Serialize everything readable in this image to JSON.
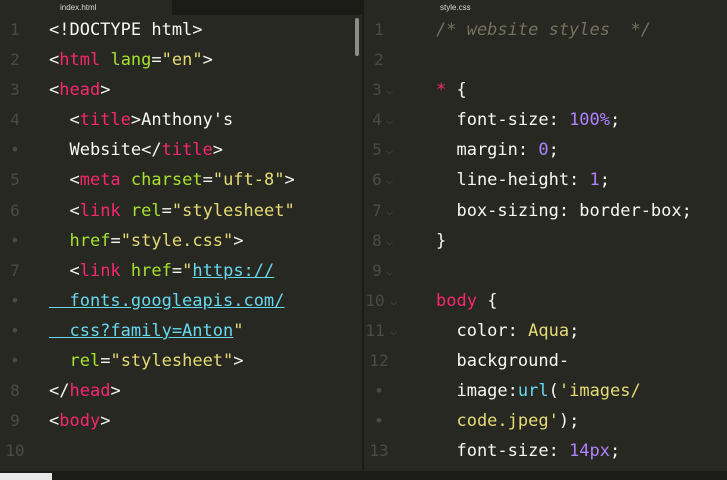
{
  "tabs": {
    "left": "index.html",
    "right": "style.css"
  },
  "left_lines": [
    {
      "num": "1",
      "parts": [
        [
          "tx",
          "<!DOCTYPE html>"
        ]
      ]
    },
    {
      "num": "2",
      "parts": [
        [
          "tx",
          "<"
        ],
        [
          "tg",
          "html"
        ],
        [
          "tx",
          " "
        ],
        [
          "at",
          "lang"
        ],
        [
          "tx",
          "="
        ],
        [
          "st",
          "\"en\""
        ],
        [
          "tx",
          ">"
        ]
      ]
    },
    {
      "num": "3",
      "parts": [
        [
          "tx",
          "<"
        ],
        [
          "tg",
          "head"
        ],
        [
          "tx",
          ">"
        ]
      ]
    },
    {
      "num": "4",
      "parts": [
        [
          "tx",
          "  <"
        ],
        [
          "tg",
          "title"
        ],
        [
          "tx",
          ">Anthony's"
        ]
      ]
    },
    {
      "num": "•",
      "parts": [
        [
          "tx",
          "  Website</"
        ],
        [
          "tg",
          "title"
        ],
        [
          "tx",
          ">"
        ]
      ]
    },
    {
      "num": "5",
      "parts": [
        [
          "tx",
          "  <"
        ],
        [
          "tg",
          "meta"
        ],
        [
          "tx",
          " "
        ],
        [
          "at",
          "charset"
        ],
        [
          "tx",
          "="
        ],
        [
          "st",
          "\"uft-8\""
        ],
        [
          "tx",
          ">"
        ]
      ]
    },
    {
      "num": "6",
      "parts": [
        [
          "tx",
          "  <"
        ],
        [
          "tg",
          "link"
        ],
        [
          "tx",
          " "
        ],
        [
          "at",
          "rel"
        ],
        [
          "tx",
          "="
        ],
        [
          "st",
          "\"stylesheet\""
        ]
      ]
    },
    {
      "num": "•",
      "parts": [
        [
          "tx",
          "  "
        ],
        [
          "at",
          "href"
        ],
        [
          "tx",
          "="
        ],
        [
          "st",
          "\"style.css\""
        ],
        [
          "tx",
          ">"
        ]
      ]
    },
    {
      "num": "7",
      "parts": [
        [
          "tx",
          "  <"
        ],
        [
          "tg",
          "link"
        ],
        [
          "tx",
          " "
        ],
        [
          "at",
          "href"
        ],
        [
          "tx",
          "="
        ],
        [
          "st",
          "\""
        ],
        [
          "un",
          "https://"
        ]
      ]
    },
    {
      "num": "•",
      "parts": [
        [
          "un",
          "  fonts.googleapis.com/"
        ]
      ]
    },
    {
      "num": "•",
      "parts": [
        [
          "un",
          "  css?family=Anton"
        ],
        [
          "st",
          "\""
        ]
      ]
    },
    {
      "num": "•",
      "parts": [
        [
          "tx",
          "  "
        ],
        [
          "at",
          "rel"
        ],
        [
          "tx",
          "="
        ],
        [
          "st",
          "\"stylesheet\""
        ],
        [
          "tx",
          ">"
        ]
      ]
    },
    {
      "num": "8",
      "parts": [
        [
          "tx",
          "</"
        ],
        [
          "tg",
          "head"
        ],
        [
          "tx",
          ">"
        ]
      ]
    },
    {
      "num": "9",
      "parts": [
        [
          "tx",
          "<"
        ],
        [
          "tg",
          "body"
        ],
        [
          "tx",
          ">"
        ]
      ]
    },
    {
      "num": "10",
      "parts": []
    }
  ],
  "right_lines": [
    {
      "num": "1",
      "fold": "",
      "parts": [
        [
          "cm",
          "/* website styles  */"
        ]
      ]
    },
    {
      "num": "2",
      "fold": "",
      "parts": []
    },
    {
      "num": "3",
      "fold": "v",
      "parts": [
        [
          "tg",
          "*"
        ],
        [
          "tx",
          " {"
        ]
      ]
    },
    {
      "num": "4",
      "fold": "v",
      "parts": [
        [
          "pr",
          "  font-size: "
        ],
        [
          "nm",
          "100%"
        ],
        [
          "tx",
          ";"
        ]
      ]
    },
    {
      "num": "5",
      "fold": "v",
      "parts": [
        [
          "pr",
          "  margin: "
        ],
        [
          "nm",
          "0"
        ],
        [
          "tx",
          ";"
        ]
      ]
    },
    {
      "num": "6",
      "fold": "v",
      "parts": [
        [
          "pr",
          "  line-height: "
        ],
        [
          "nm",
          "1"
        ],
        [
          "tx",
          ";"
        ]
      ]
    },
    {
      "num": "7",
      "fold": "v",
      "parts": [
        [
          "pr",
          "  box-sizing: border-box;"
        ]
      ]
    },
    {
      "num": "8",
      "fold": "v",
      "parts": [
        [
          "tx",
          "}"
        ]
      ]
    },
    {
      "num": "9",
      "fold": "v",
      "parts": []
    },
    {
      "num": "10",
      "fold": "v",
      "parts": [
        [
          "tg",
          "body"
        ],
        [
          "tx",
          " {"
        ]
      ]
    },
    {
      "num": "11",
      "fold": "v",
      "parts": [
        [
          "pr",
          "  color: "
        ],
        [
          "st",
          "Aqua"
        ],
        [
          "tx",
          ";"
        ]
      ]
    },
    {
      "num": "12",
      "fold": "",
      "parts": [
        [
          "pr",
          "  background-"
        ]
      ]
    },
    {
      "num": "•",
      "fold": "",
      "parts": [
        [
          "pr",
          "  image:"
        ],
        [
          "kw",
          "url"
        ],
        [
          "tx",
          "("
        ],
        [
          "st",
          "'images/"
        ]
      ]
    },
    {
      "num": "•",
      "fold": "",
      "parts": [
        [
          "st",
          "  code.jpeg'"
        ],
        [
          "tx",
          ");"
        ]
      ]
    },
    {
      "num": "13",
      "fold": "",
      "parts": [
        [
          "pr",
          "  font-size: "
        ],
        [
          "nm",
          "14px"
        ],
        [
          "tx",
          ";"
        ]
      ]
    }
  ]
}
